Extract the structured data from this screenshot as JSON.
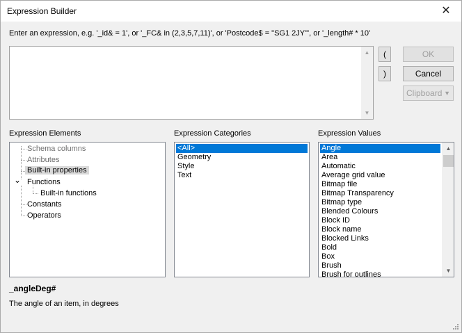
{
  "window": {
    "title": "Expression Builder",
    "close_glyph": "✕"
  },
  "prompt": "Enter an expression, e.g. '_id& = 1', or '_FC& in (2,3,5,7,11)', or 'Postcode$ = \"SG1 2JY\"', or '_length# * 10'",
  "buttons": {
    "open_paren": "(",
    "close_paren": ")",
    "ok": "OK",
    "cancel": "Cancel",
    "clipboard": "Clipboard",
    "clipboard_arrow": "▼"
  },
  "elements": {
    "label": "Expression Elements",
    "items": [
      {
        "label": "Schema columns"
      },
      {
        "label": "Attributes"
      },
      {
        "label": "Built-in properties"
      },
      {
        "label": "Functions",
        "expander": "⌄"
      },
      {
        "label": "Built-in functions"
      },
      {
        "label": "Constants"
      },
      {
        "label": "Operators"
      }
    ]
  },
  "categories": {
    "label": "Expression Categories",
    "items": [
      "<All>",
      "Geometry",
      "Style",
      "Text"
    ]
  },
  "values": {
    "label": "Expression Values",
    "items": [
      "Angle",
      "Area",
      "Automatic",
      "Average grid value",
      "Bitmap file",
      "Bitmap Transparency",
      "Bitmap type",
      "Blended Colours",
      "Block ID",
      "Block name",
      "Blocked Links",
      "Bold",
      "Box",
      "Brush",
      "Brush for outlines"
    ],
    "scroll_up": "▲",
    "scroll_down": "▼"
  },
  "selected": {
    "name": "_angleDeg#",
    "description": "The angle of an item, in degrees"
  },
  "colors": {
    "selection": "#0078d7",
    "tree_selection": "#d9d9d9"
  }
}
